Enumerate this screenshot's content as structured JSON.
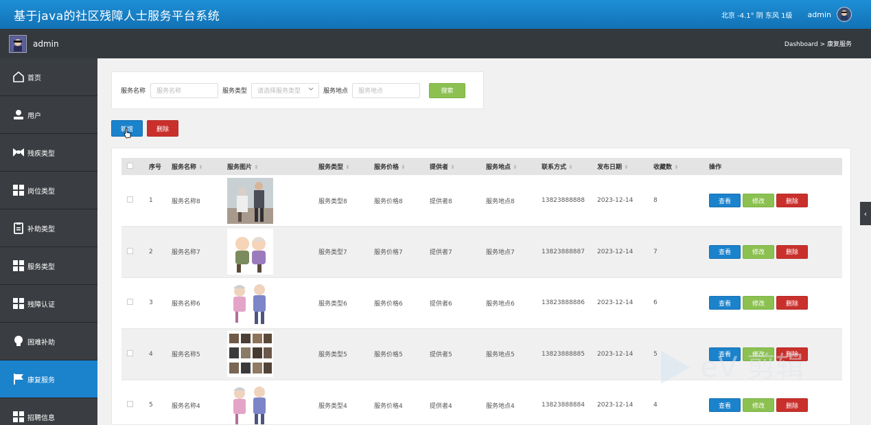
{
  "header": {
    "title": "基于java的社区残障人士服务平台系统",
    "weather": "北京  -4.1°  阴  东风  1级",
    "username": "admin"
  },
  "subbar": {
    "username": "admin",
    "breadcrumb": "Dashboard > 康复服务"
  },
  "sidebar": {
    "items": [
      {
        "label": "首页",
        "icon": "home-icon"
      },
      {
        "label": "用户",
        "icon": "user-icon"
      },
      {
        "label": "残疾类型",
        "icon": "bow-icon"
      },
      {
        "label": "岗位类型",
        "icon": "grid-icon"
      },
      {
        "label": "补助类型",
        "icon": "clipboard-icon"
      },
      {
        "label": "服务类型",
        "icon": "grid-icon"
      },
      {
        "label": "残障认证",
        "icon": "grid-icon"
      },
      {
        "label": "困难补助",
        "icon": "bulb-icon"
      },
      {
        "label": "康复服务",
        "icon": "flag-icon",
        "active": true
      },
      {
        "label": "招聘信息",
        "icon": "grid-icon"
      }
    ]
  },
  "search": {
    "name_label": "服务名称",
    "name_placeholder": "服务名称",
    "type_label": "服务类型",
    "type_placeholder": "请选择服务类型",
    "place_label": "服务地点",
    "place_placeholder": "服务地点",
    "search_button": "搜索"
  },
  "toolbar": {
    "add_button": "新增",
    "delete_button": "删除"
  },
  "table": {
    "columns": [
      "序号",
      "服务名称",
      "服务图片",
      "服务类型",
      "服务价格",
      "提供者",
      "服务地点",
      "联系方式",
      "发布日期",
      "收藏数",
      "操作"
    ],
    "rows": [
      {
        "index": "1",
        "name": "服务名称8",
        "type": "服务类型8",
        "price": "服务价格8",
        "provider": "提供者8",
        "place": "服务地点8",
        "phone": "13823888888",
        "date": "2023-12-14",
        "fav": "8"
      },
      {
        "index": "2",
        "name": "服务名称7",
        "type": "服务类型7",
        "price": "服务价格7",
        "provider": "提供者7",
        "place": "服务地点7",
        "phone": "13823888887",
        "date": "2023-12-14",
        "fav": "7"
      },
      {
        "index": "3",
        "name": "服务名称6",
        "type": "服务类型6",
        "price": "服务价格6",
        "provider": "提供者6",
        "place": "服务地点6",
        "phone": "13823888886",
        "date": "2023-12-14",
        "fav": "6"
      },
      {
        "index": "4",
        "name": "服务名称5",
        "type": "服务类型5",
        "price": "服务价格5",
        "provider": "提供者5",
        "place": "服务地点5",
        "phone": "13823888885",
        "date": "2023-12-14",
        "fav": "5"
      },
      {
        "index": "5",
        "name": "服务名称4",
        "type": "服务类型4",
        "price": "服务价格4",
        "provider": "提供者4",
        "place": "服务地点4",
        "phone": "13823888884",
        "date": "2023-12-14",
        "fav": "4"
      }
    ],
    "actions": {
      "view": "查看",
      "edit": "修改",
      "delete": "删除"
    }
  },
  "colors": {
    "header_blue": "#1b82cc",
    "green": "#8cc152",
    "red": "#c9302c",
    "sidebar_bg": "#3a3d41"
  }
}
